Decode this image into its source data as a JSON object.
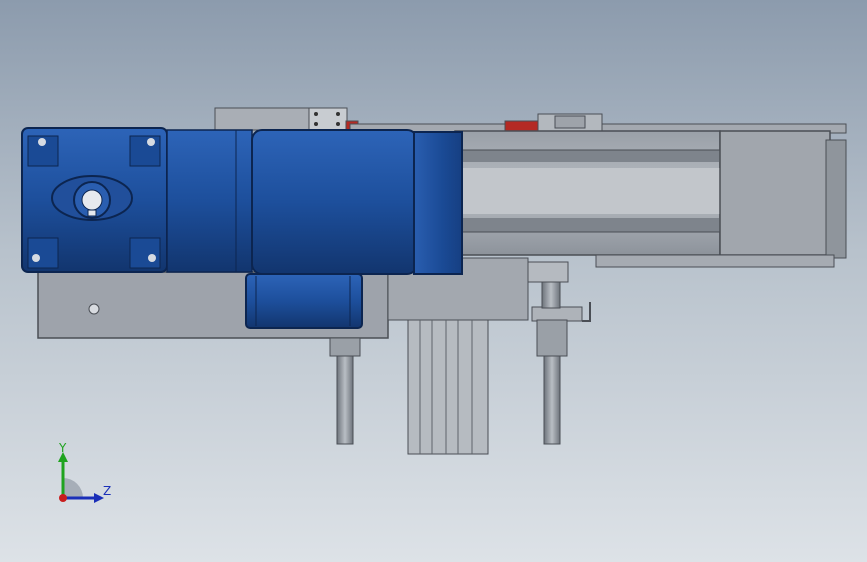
{
  "view": {
    "background_top": "#8c9bad",
    "background_bottom": "#dde2e7"
  },
  "model": {
    "motor_color": "#1f4f9a",
    "frame_color": "#8e949d",
    "rail_color": "#a7acb3",
    "accent_color": "#b42a24"
  },
  "triad": {
    "y_label": "Y",
    "z_label": "Z",
    "y_color": "#1fa31f",
    "z_color": "#1a2fb8",
    "x_color": "#c81d1d"
  }
}
